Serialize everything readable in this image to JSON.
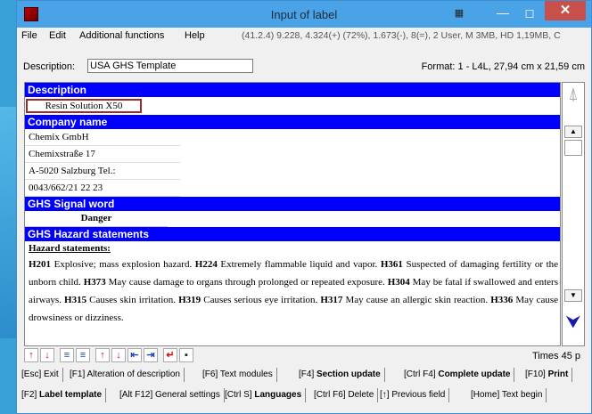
{
  "window": {
    "title": "Input of label"
  },
  "menu": {
    "items": [
      "File",
      "Edit",
      "Additional functions",
      "Help"
    ],
    "status": "(41.2.4) 9.228, 4.324(+) (72%), 1.673(-), 8(=), 2 User, M 3MB, HD 1,19MB, C"
  },
  "description": {
    "label": "Description:",
    "value": "USA GHS Template"
  },
  "format": "Format: 1 - L4L, 27,94 cm x 21,59 cm",
  "sections": {
    "description": {
      "header": "Description",
      "value": "Resin Solution X50"
    },
    "company": {
      "header": "Company name",
      "lines": [
        "Chemix GmbH",
        "Chemixstraße 17",
        "A-5020 Salzburg   Tel.:",
        "0043/662/21 22 23"
      ]
    },
    "signal": {
      "header": "GHS Signal word",
      "value": "Danger"
    },
    "hazard": {
      "header": "GHS Hazard statements",
      "subheader": "Hazard statements:",
      "statements": [
        {
          "code": "H201",
          "text": "Explosive; mass explosion hazard."
        },
        {
          "code": "H224",
          "text": "Extremely flammable liquid and vapor."
        },
        {
          "code": "H361",
          "text": "Suspected of damaging fertility or the unborn child."
        },
        {
          "code": "H373",
          "text": "May cause damage to organs through prolonged or repeated exposure."
        },
        {
          "code": "H304",
          "text": "May be fatal if swallowed and enters airways."
        },
        {
          "code": "H315",
          "text": "Causes skin irritation."
        },
        {
          "code": "H319",
          "text": "Causes serious eye irritation."
        },
        {
          "code": "H317",
          "text": "May cause an allergic skin reaction."
        },
        {
          "code": "H336",
          "text": "May cause drowsiness or dizziness."
        }
      ]
    }
  },
  "toolbar": {
    "font": "Times 45 p"
  },
  "fkeys_row1": [
    {
      "key": "[Esc]",
      "label": "Exit",
      "bold": false
    },
    {
      "key": "[F1]",
      "label": "Alteration of description",
      "bold": false
    },
    {
      "key": "[F6]",
      "label": "Text modules",
      "bold": false
    },
    {
      "key": "[F4]",
      "label": "Section update",
      "bold": true
    },
    {
      "key": "[Ctrl F4]",
      "label": "Complete update",
      "bold": true
    },
    {
      "key": "[F10]",
      "label": "Print",
      "bold": true
    }
  ],
  "fkeys_row2": [
    {
      "key": "[F2]",
      "label": "Label template",
      "bold": true
    },
    {
      "key": "[Alt F12]",
      "label": "General settings",
      "bold": false
    },
    {
      "key": "[Ctrl S]",
      "label": "Languages",
      "bold": true
    },
    {
      "key": "[Ctrl F6]",
      "label": "Delete",
      "bold": false
    },
    {
      "key": "[↑]",
      "label": "Previous field",
      "bold": false
    },
    {
      "key": "[Home]",
      "label": "Text begin",
      "bold": false
    }
  ],
  "colors": {
    "section_header": "#0000ff",
    "titlebar": "#4aa3e6",
    "close": "#c7504a",
    "accent_red": "#dd0000"
  }
}
